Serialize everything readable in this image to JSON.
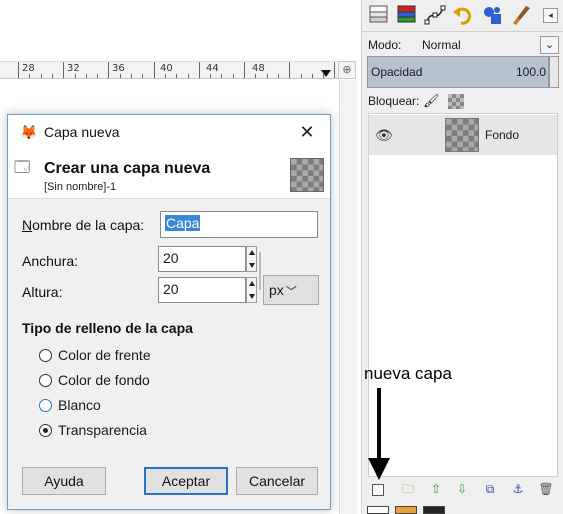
{
  "ruler": {
    "labels": [
      "28",
      "32",
      "36",
      "40",
      "44",
      "48"
    ]
  },
  "dock": {
    "tabs": [
      "layers-icon",
      "channels-icon",
      "paths-icon",
      "undo-icon",
      "brushes-icon",
      "paint-icon"
    ],
    "mode_label": "Modo:",
    "mode_value": "Normal",
    "opacity_label": "Opacidad",
    "opacity_value": "100.0",
    "lock_label": "Bloquear:",
    "layer_name": "Fondo"
  },
  "annotation": {
    "text": "nueva capa"
  },
  "dialog": {
    "title": "Capa nueva",
    "header_title": "Crear una capa nueva",
    "header_subtitle": "[Sin nombre]-1",
    "name_label_u": "N",
    "name_label_rest": "ombre de la capa:",
    "name_value": "Capa",
    "width_label": "Anchura:",
    "width_value": "20",
    "height_label": "Altura:",
    "height_value": "20",
    "unit_value": "px",
    "fill_heading": "Tipo de relleno de la capa",
    "fill_options": [
      "Color de frente",
      "Color de fondo",
      "Blanco",
      "Transparencia"
    ],
    "fill_selected": "Transparencia",
    "help_u": "y",
    "help_pre": "Ay",
    "help_label": "Ayuda",
    "accept_label": "Aceptar",
    "cancel_label": "Cancelar"
  },
  "colors": {
    "accent": "#3a87d8",
    "opacity_bar": "#b6c3cf",
    "dialog_border": "#6a9fd4"
  }
}
